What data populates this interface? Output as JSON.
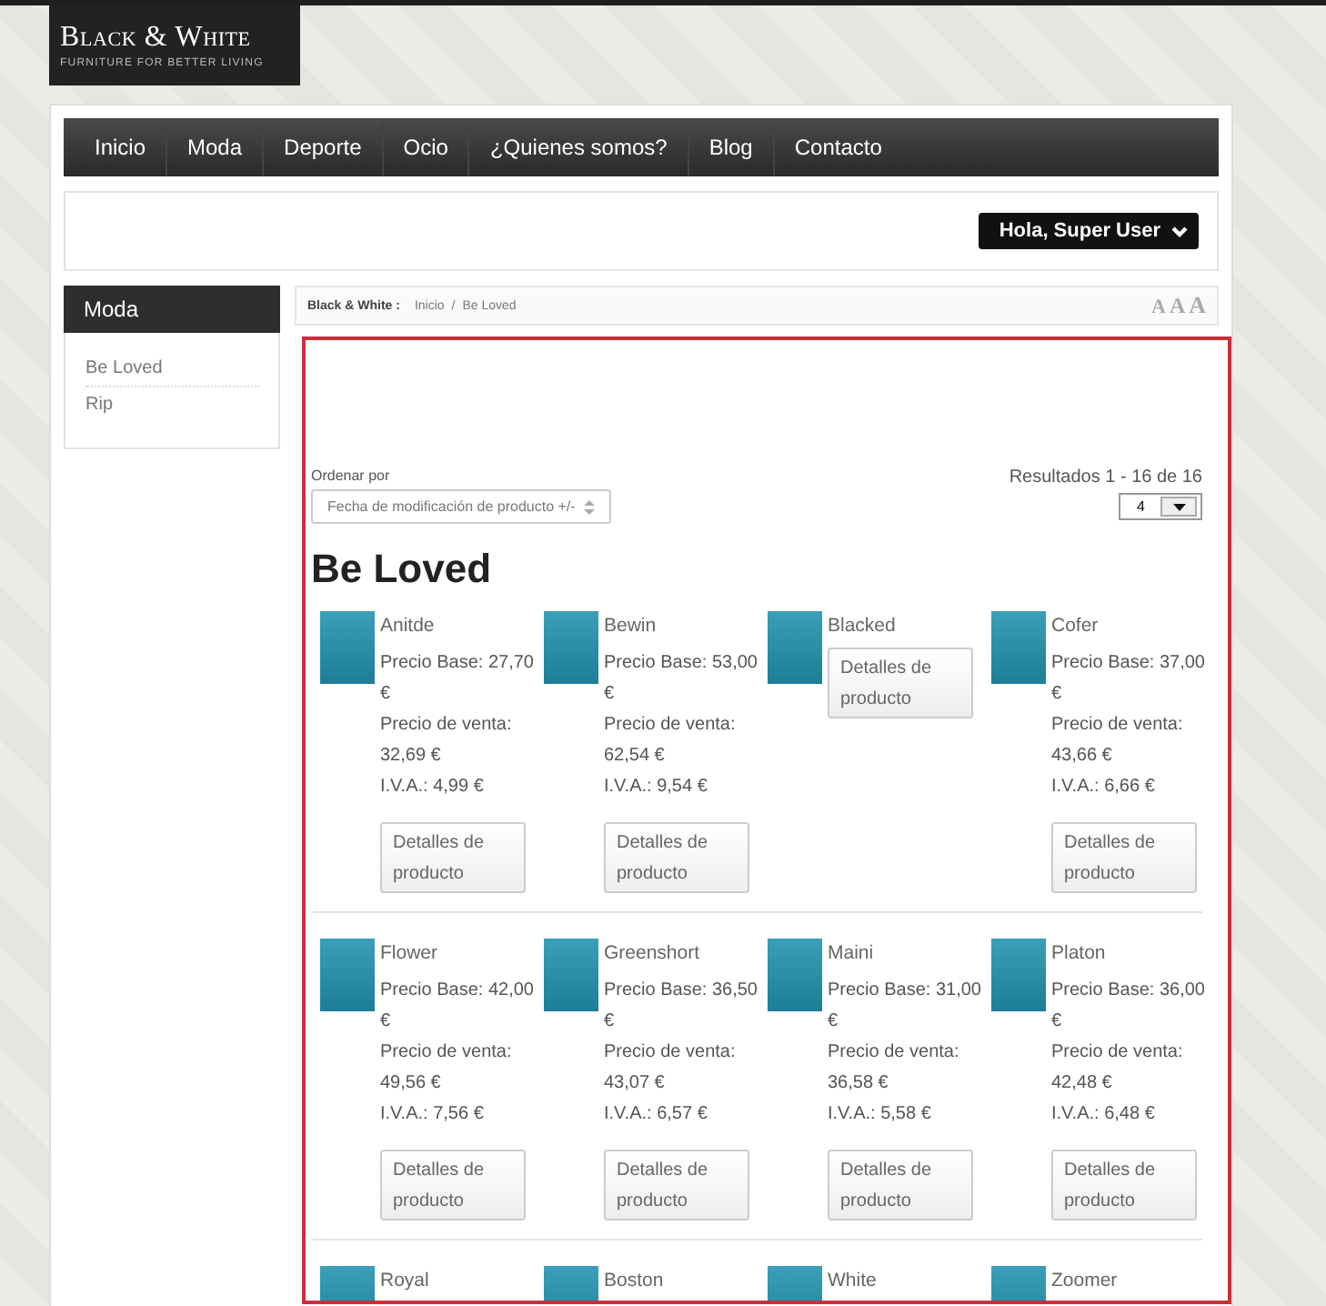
{
  "logo": {
    "title": "Black & White",
    "tagline": "FURNITURE FOR BETTER LIVING"
  },
  "nav": [
    {
      "label": "Inicio"
    },
    {
      "label": "Moda"
    },
    {
      "label": "Deporte"
    },
    {
      "label": "Ocio"
    },
    {
      "label": "¿Quienes somos?"
    },
    {
      "label": "Blog"
    },
    {
      "label": "Contacto"
    }
  ],
  "user_menu": {
    "label": "Hola, Super User"
  },
  "sidebar": {
    "title": "Moda",
    "items": [
      {
        "label": "Be Loved"
      },
      {
        "label": "Rip"
      }
    ]
  },
  "breadcrumb": {
    "site": "Black & White :",
    "items": [
      "Inicio",
      "/",
      "Be Loved"
    ]
  },
  "font_size_controls": [
    "A",
    "A",
    "A"
  ],
  "sort": {
    "label": "Ordenar por",
    "value": "Fecha de modificación de producto +/-"
  },
  "results": {
    "text": "Resultados 1 - 16 de 16",
    "per_page": "4"
  },
  "category_title": "Be Loved",
  "product_rows": [
    {
      "products": [
        {
          "name": "Anitde",
          "base_price": "Precio Base: 27,70 €",
          "sale_label": "Precio de venta:",
          "sale_price": "32,69 €",
          "iva": "I.V.A.: 4,99 €",
          "button": "Detalles de producto"
        },
        {
          "name": "Bewin",
          "base_price": "Precio Base: 53,00 €",
          "sale_label": "Precio de venta:",
          "sale_price": "62,54 €",
          "iva": "I.V.A.: 9,54 €",
          "button": "Detalles de producto"
        },
        {
          "name": "Blacked",
          "button": "Detalles de producto"
        },
        {
          "name": "Cofer",
          "base_price": "Precio Base: 37,00 €",
          "sale_label": "Precio de venta:",
          "sale_price": "43,66 €",
          "iva": "I.V.A.: 6,66 €",
          "button": "Detalles de producto"
        }
      ]
    },
    {
      "products": [
        {
          "name": "Flower",
          "base_price": "Precio Base: 42,00 €",
          "sale_label": "Precio de venta:",
          "sale_price": "49,56 €",
          "iva": "I.V.A.: 7,56 €",
          "button": "Detalles de producto"
        },
        {
          "name": "Greenshort",
          "base_price": "Precio Base: 36,50 €",
          "sale_label": "Precio de venta:",
          "sale_price": "43,07 €",
          "iva": "I.V.A.: 6,57 €",
          "button": "Detalles de producto"
        },
        {
          "name": "Maini",
          "base_price": "Precio Base: 31,00 €",
          "sale_label": "Precio de venta:",
          "sale_price": "36,58 €",
          "iva": "I.V.A.: 5,58 €",
          "button": "Detalles de producto"
        },
        {
          "name": "Platon",
          "base_price": "Precio Base: 36,00 €",
          "sale_label": "Precio de venta:",
          "sale_price": "42,48 €",
          "iva": "I.V.A.: 6,48 €",
          "button": "Detalles de producto"
        }
      ]
    },
    {
      "products": [
        {
          "name": "Royal"
        },
        {
          "name": "Boston"
        },
        {
          "name": "White"
        },
        {
          "name": "Zoomer"
        }
      ]
    }
  ]
}
